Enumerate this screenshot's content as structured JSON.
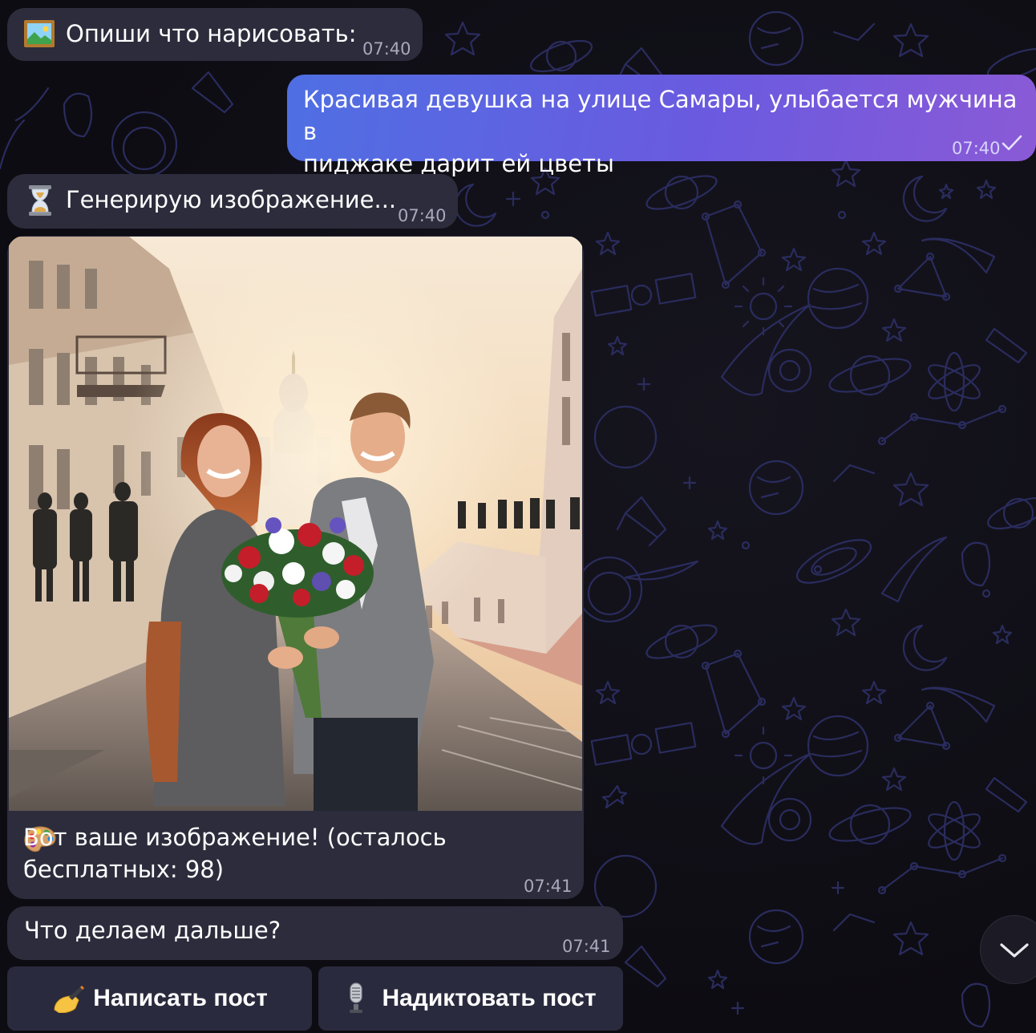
{
  "messages": [
    {
      "id": "m1",
      "direction": "in",
      "icon": "framed-picture-icon",
      "text": "Опиши что нарисовать:",
      "time": "07:40"
    },
    {
      "id": "m2",
      "direction": "out",
      "text": "Красивая девушка на улице Самары, улыбается мужчина в\nпиджаке дарит ей цветы",
      "time": "07:40",
      "status": "sent-check"
    },
    {
      "id": "m3",
      "direction": "in",
      "icon": "hourglass-icon",
      "text": "Генерирую изображение...",
      "time": "07:40"
    },
    {
      "id": "m4",
      "direction": "in",
      "type": "photo",
      "icon": "palette-icon",
      "photo": "generated-image-couple-with-flowers",
      "caption": "Вот ваше изображение! (осталось\nбесплатных: 98)",
      "time": "07:41"
    },
    {
      "id": "m5",
      "direction": "in",
      "text": "Что делаем дальше?",
      "time": "07:41"
    }
  ],
  "keyboard": {
    "buttons": [
      {
        "icon": "writing-hand-icon",
        "label": "Написать пост"
      },
      {
        "icon": "microphone-icon",
        "label": "Надиктовать пост"
      }
    ]
  },
  "scroll_button": {
    "icon": "chevron-down-icon"
  },
  "colors": {
    "background": "#0e0e12",
    "incoming_bubble": "#2c2c3c",
    "outgoing_gradient_start": "#4f6fe3",
    "outgoing_gradient_end": "#8a5ad6",
    "pattern": "#2a2c5e",
    "keyboard_button": "#2a2a3e"
  }
}
